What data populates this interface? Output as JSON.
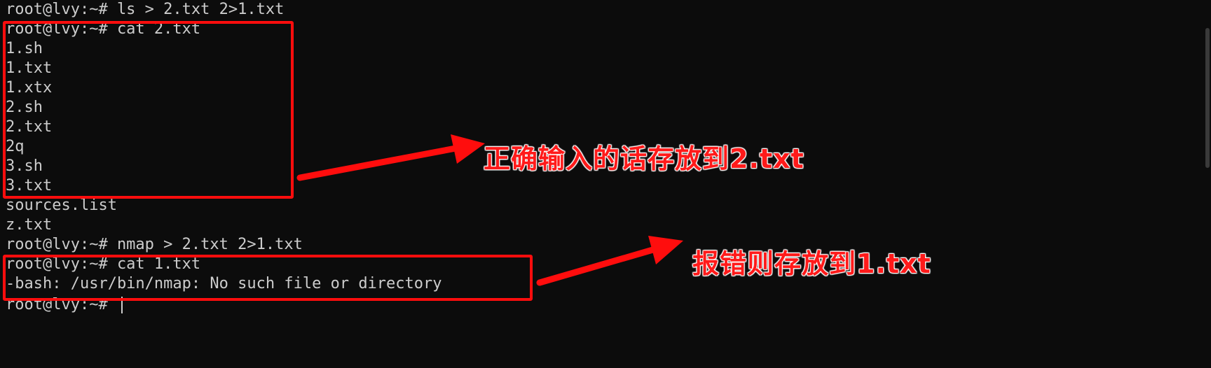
{
  "terminal": {
    "lines": [
      "root@lvy:~# ls > 2.txt 2>1.txt",
      "root@lvy:~# cat 2.txt",
      "1.sh",
      "1.txt",
      "1.xtx",
      "2.sh",
      "2.txt",
      "2q",
      "3.sh",
      "3.txt",
      "sources.list",
      "z.txt",
      "root@lvy:~# nmap > 2.txt 2>1.txt",
      "root@lvy:~# cat 1.txt",
      "-bash: /usr/bin/nmap: No such file or directory",
      "root@lvy:~# "
    ]
  },
  "annotations": {
    "stdout_note": "正确输入的话存放到2.txt",
    "stderr_note": "报错则存放到1.txt",
    "color": "#ff0d0d"
  },
  "colors": {
    "background": "#0c0c0c",
    "text": "#cccccc"
  }
}
